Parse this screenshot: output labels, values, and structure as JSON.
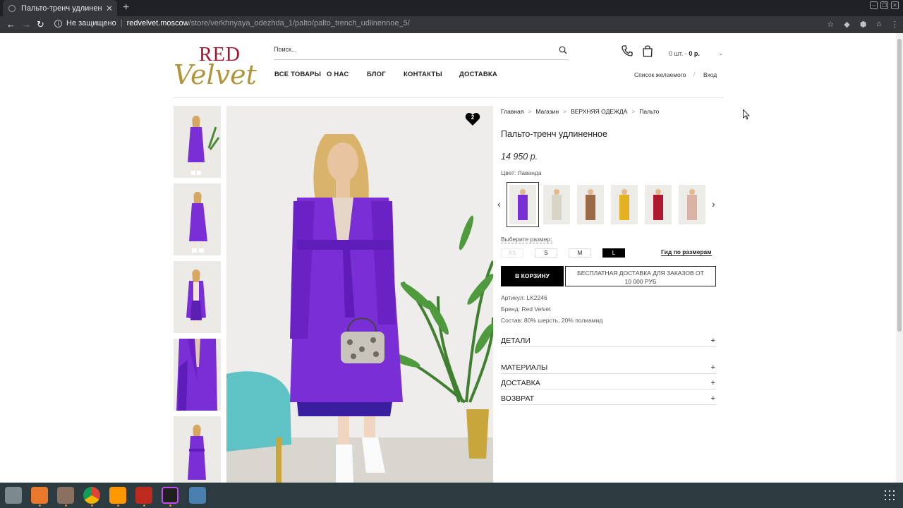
{
  "browser": {
    "tab_title": "Пальто-тренч удлиненно",
    "address": {
      "security": "Не защищено",
      "host": "redvelvet.moscow",
      "path": "/store/verkhnyaya_odezhda_1/palto/palto_trench_udlinennoe_5/"
    }
  },
  "header": {
    "logo_top": "RED",
    "logo_bottom": "Velvet",
    "search_placeholder": "Поиск...",
    "menu": [
      "ВСЕ ТОВАРЫ",
      "О НАС",
      "БЛОГ",
      "КОНТАКТЫ",
      "ДОСТАВКА"
    ],
    "cart_count": "0 шт.",
    "cart_sep": " - ",
    "cart_total": "0 р.",
    "wishlist": "Список желаемого",
    "login": "Вход"
  },
  "gallery": {
    "wishlist_count": "2",
    "thumb_count": 5
  },
  "product": {
    "breadcrumbs": [
      "Главная",
      "Магазин",
      "ВЕРХНЯЯ ОДЕЖДА",
      "Пальто"
    ],
    "title": "Пальто-тренч удлиненное",
    "price": "14 950 р.",
    "color_label": "Цвет: Лаванда",
    "swatch_colors": [
      "#7a2ed6",
      "#d9d4c8",
      "#9a6a45",
      "#e5b020",
      "#b01830",
      "#d9b3a3"
    ],
    "size_label": "Выберите размер:",
    "sizes": [
      {
        "label": "XS",
        "state": "disabled"
      },
      {
        "label": "S",
        "state": "available"
      },
      {
        "label": "M",
        "state": "available"
      },
      {
        "label": "L",
        "state": "selected"
      }
    ],
    "size_guide": "Гид по размерам",
    "add_to_cart": "В КОРЗИНУ",
    "shipping_line1": "БЕСПЛАТНАЯ ДОСТАВКА ДЛЯ ЗАКАЗОВ ОТ",
    "shipping_line2": "10 000 РУБ",
    "sku": "Артикул: LK2246",
    "brand": "Бренд: Red Velvet",
    "composition": "Состав: 80% шерсть, 20% полиамид",
    "accordions": [
      "ДЕТАЛИ",
      "МАТЕРИАЛЫ",
      "ДОСТАВКА",
      "ВОЗВРАТ"
    ]
  },
  "colors": {
    "brand_red": "#a4142c",
    "brand_gold": "#b0953a",
    "coat_purple": "#7a2ed6"
  }
}
